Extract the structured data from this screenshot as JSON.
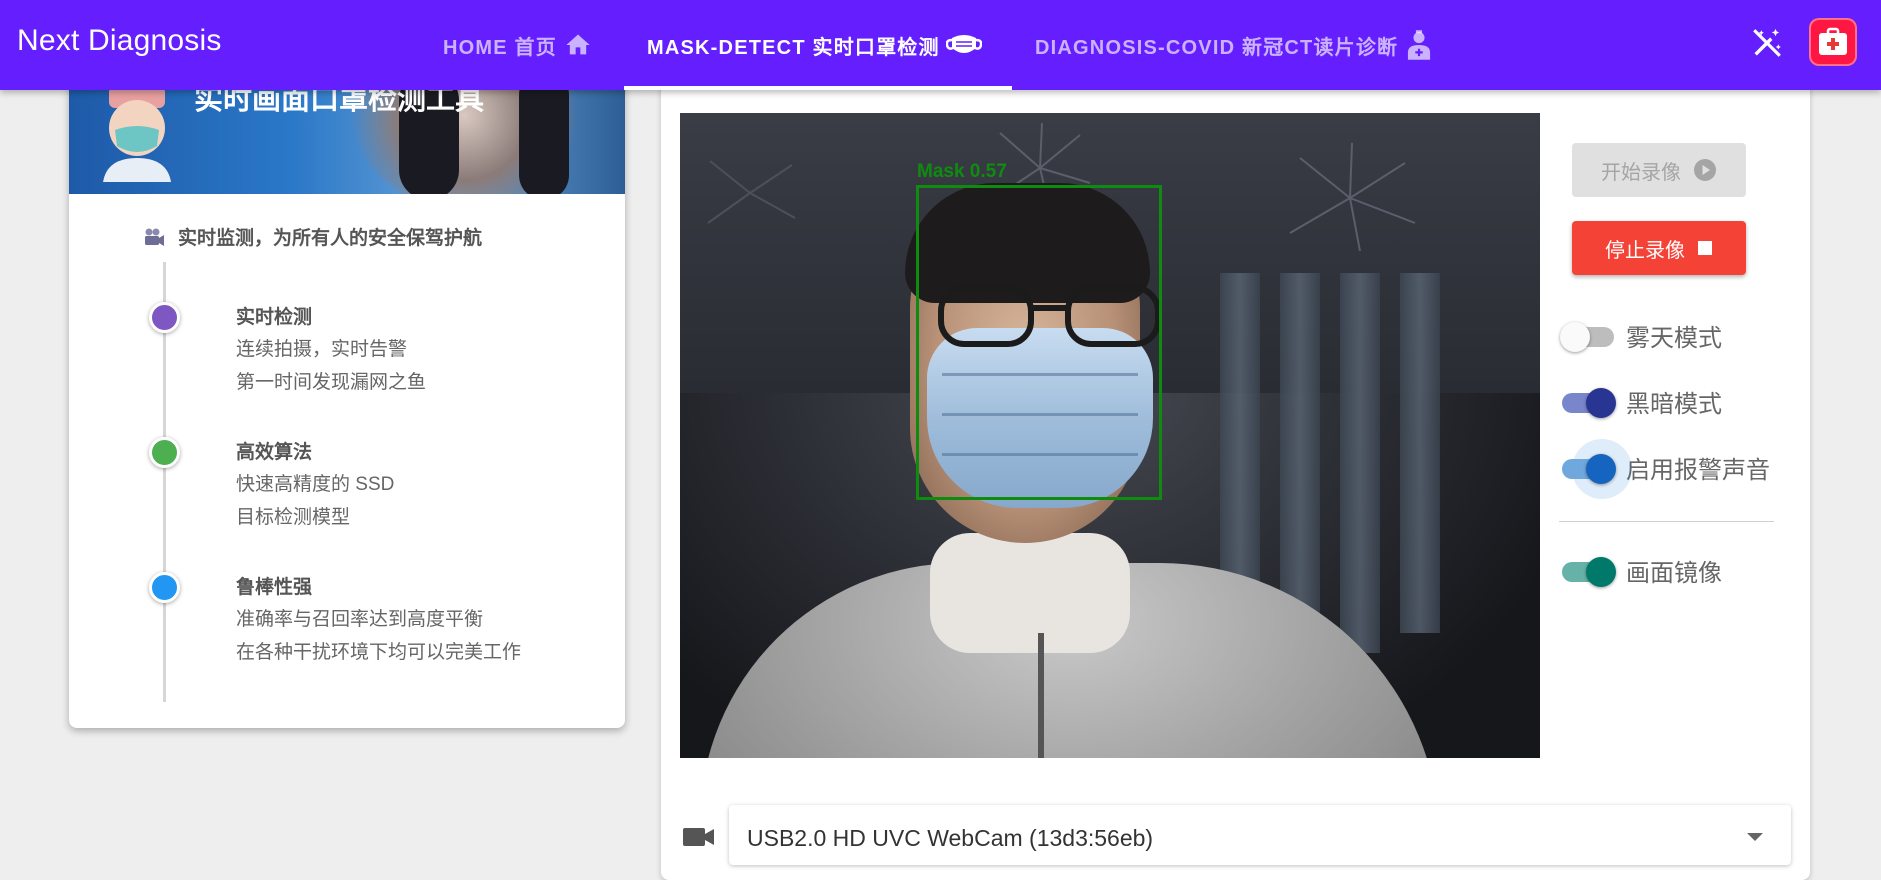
{
  "appbar": {
    "brand": "Next Diagnosis",
    "tabs": [
      {
        "label": "HOME 首页",
        "icon": "home-icon",
        "active": false
      },
      {
        "label": "MASK-DETECT 实时口罩检测",
        "icon": "mask-icon",
        "active": true
      },
      {
        "label": "DIAGNOSIS-COVID 新冠CT读片诊断",
        "icon": "doctor-icon",
        "active": false
      }
    ],
    "actions": [
      {
        "icon": "auto-fix-off-icon"
      },
      {
        "icon": "medical-kit-logo-icon"
      }
    ],
    "colors": {
      "bar": "#651fff",
      "logo": "#ff1744"
    }
  },
  "left_card": {
    "banner_title": "实时画面口罩检测工具",
    "header": {
      "icon": "movie-camera-icon",
      "text": "实时监测，为所有人的安全保驾护航"
    },
    "timeline": [
      {
        "title": "实时检测",
        "lines": [
          "连续拍摄，实时告警",
          "第一时间发现漏网之鱼"
        ],
        "color": "#7e57c2"
      },
      {
        "title": "高效算法",
        "lines": [
          "快速高精度的 SSD",
          "目标检测模型"
        ],
        "color": "#4caf50"
      },
      {
        "title": "鲁棒性强",
        "lines": [
          "准确率与召回率达到高度平衡",
          "在各种干扰环境下均可以完美工作"
        ],
        "color": "#2196f3"
      }
    ]
  },
  "video": {
    "detection_label": "Mask 0.57",
    "box_color": "#0f8c0f"
  },
  "controls": {
    "start_button": {
      "label": "开始录像",
      "icon": "play-circle-icon",
      "disabled": true
    },
    "stop_button": {
      "label": "停止录像",
      "icon": "stop-icon",
      "color": "#f44336"
    },
    "switches": [
      {
        "label": "雾天模式",
        "on": false,
        "color": "#fafafa"
      },
      {
        "label": "黑暗模式",
        "on": true,
        "color": "#283593"
      },
      {
        "label": "启用报警声音",
        "on": true,
        "color": "#1565c0",
        "focused": true
      },
      {
        "label": "画面镜像",
        "on": true,
        "color": "#00796b"
      }
    ]
  },
  "camera_select": {
    "icon": "videocam-icon",
    "value": "USB2.0 HD UVC WebCam (13d3:56eb)"
  }
}
